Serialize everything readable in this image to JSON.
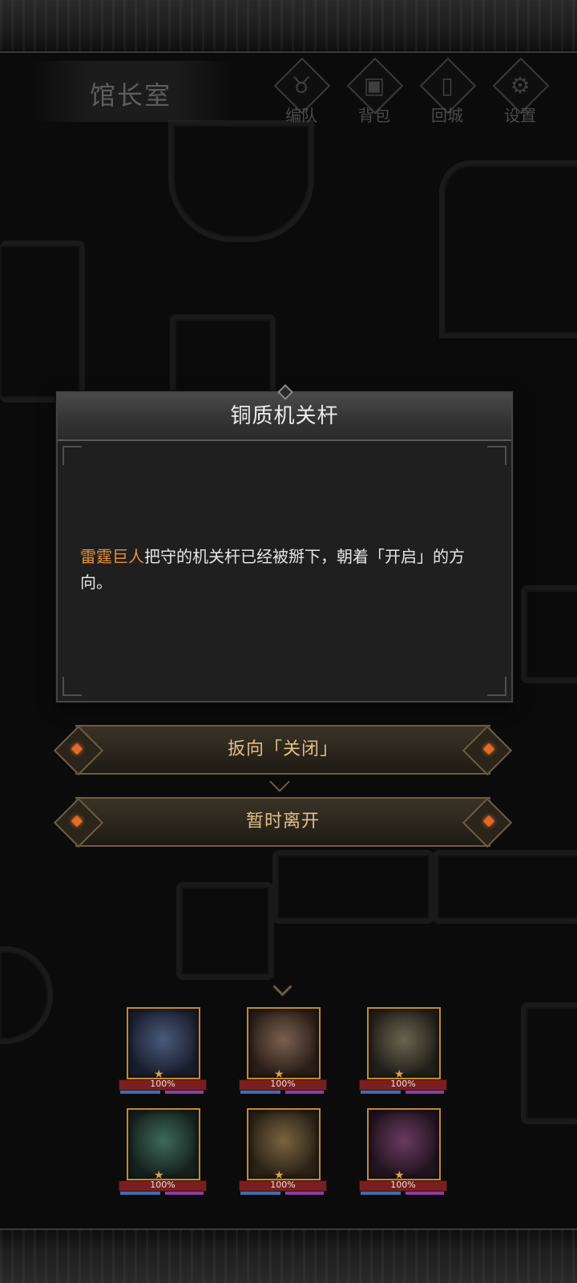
{
  "header": {
    "room_title": "馆长室",
    "nav": [
      {
        "label": "编队",
        "icon": "horned-helmet-icon"
      },
      {
        "label": "背包",
        "icon": "backpack-icon"
      },
      {
        "label": "回城",
        "icon": "door-exit-icon"
      },
      {
        "label": "设置",
        "icon": "gear-icon"
      }
    ]
  },
  "dialog": {
    "title": "铜质机关杆",
    "highlight": "雷霆巨人",
    "body": "把守的机关杆已经被掰下，朝着「开启」的方向。",
    "highlight_color": "#e7903c"
  },
  "options": [
    {
      "label": "扳向「关闭」"
    },
    {
      "label": "暂时离开"
    }
  ],
  "party": [
    {
      "hp": "100%",
      "tint": "#2a3550"
    },
    {
      "hp": "100%",
      "tint": "#4a3a2e"
    },
    {
      "hp": "100%",
      "tint": "#3e3a2a"
    },
    {
      "hp": "100%",
      "tint": "#2a4036"
    },
    {
      "hp": "100%",
      "tint": "#4a3c26"
    },
    {
      "hp": "100%",
      "tint": "#4a2a40"
    }
  ]
}
